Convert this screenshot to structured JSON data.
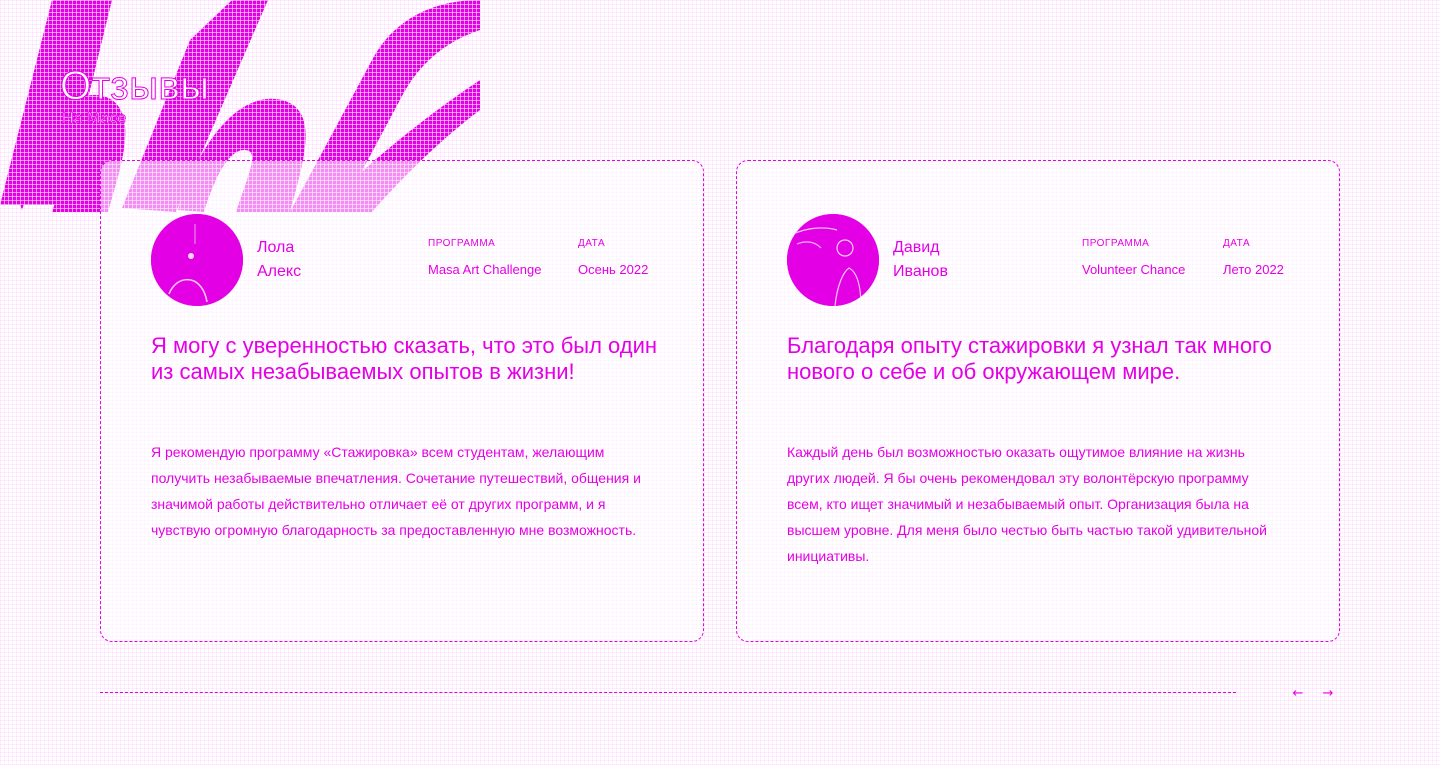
{
  "section": {
    "title": "Отзывы",
    "subtitle": "На Масе"
  },
  "testimonials": [
    {
      "name_first": "Лола",
      "name_last": "Алекс",
      "program_label": "ПРОГРАММА",
      "program_value": "Masa Art Challenge",
      "date_label": "ДАТА",
      "date_value": "Осень 2022",
      "quote": "Я могу с уверенностью сказать, что это был один из самых незабываемых опытов в жизни!",
      "body": "Я рекомендую программу «Стажировка» всем студентам, желающим получить незабываемые впечатления. Сочетание путешествий, общения и значимой работы действительно отличает её от других программ, и я чувствую огромную благодарность за предоставленную мне возможность."
    },
    {
      "name_first": "Давид",
      "name_last": "Иванов",
      "program_label": "ПРОГРАММА",
      "program_value": "Volunteer Chance",
      "date_label": "ДАТА",
      "date_value": "Лето 2022",
      "quote": "Благодаря опыту стажировки я узнал так много нового о себе и об окружающем мире.",
      "body": "Каждый день был возможностью оказать ощутимое влияние на жизнь других людей. Я бы очень рекомендовал эту волонтёрскую программу всем, кто ищет значимый и незабываемый опыт. Организация была на высшем уровне. Для меня было честью быть частью такой удивительной инициативы."
    }
  ],
  "slider": {
    "prev_icon": "←",
    "next_icon": "→",
    "progress": 0.91
  },
  "colors": {
    "accent": "#e400e4",
    "background": "#ffffff"
  },
  "icons": {
    "prev": "arrow-left-icon",
    "next": "arrow-right-icon"
  }
}
